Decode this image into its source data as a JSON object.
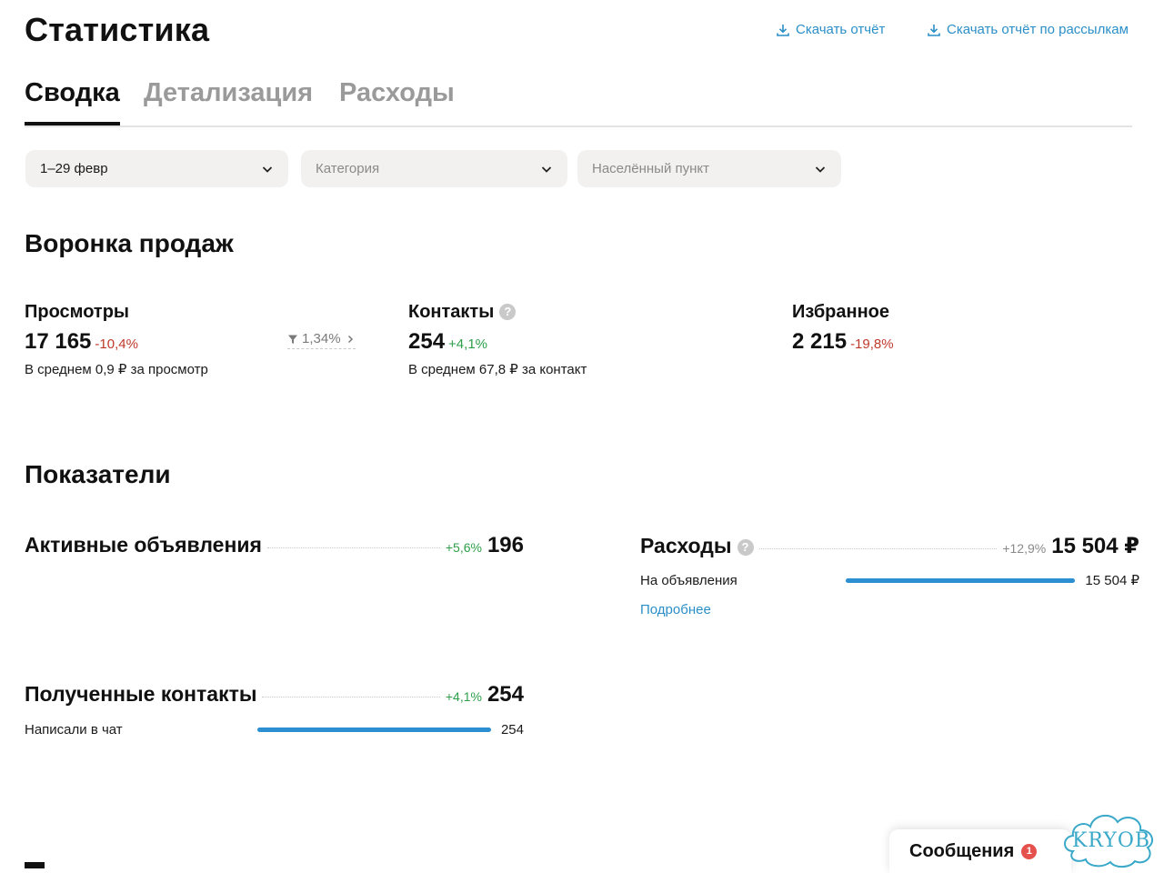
{
  "header": {
    "title": "Статистика",
    "download_report": "Скачать отчёт",
    "download_mailing_report": "Скачать отчёт по рассылкам"
  },
  "tabs": [
    {
      "label": "Сводка",
      "active": true
    },
    {
      "label": "Детализация",
      "active": false
    },
    {
      "label": "Расходы",
      "active": false
    }
  ],
  "filters": {
    "period": "1–29 февр",
    "category_placeholder": "Категория",
    "locality_placeholder": "Населённый пункт"
  },
  "funnel": {
    "title": "Воронка продаж",
    "views": {
      "label": "Просмотры",
      "value": "17 165",
      "delta": "-10,4%",
      "sub": "В среднем 0,9 ₽ за просмотр"
    },
    "conversion": "1,34%",
    "contacts": {
      "label": "Контакты",
      "value": "254",
      "delta": "+4,1%",
      "sub": "В среднем 67,8 ₽ за контакт"
    },
    "favorites": {
      "label": "Избранное",
      "value": "2 215",
      "delta": "-19,8%"
    }
  },
  "indicators": {
    "title": "Показатели",
    "active_ads": {
      "label": "Активные объявления",
      "delta": "+5,6%",
      "value": "196"
    },
    "expenses": {
      "label": "Расходы",
      "delta": "+12,9%",
      "value": "15 504 ₽",
      "breakdown": {
        "label": "На объявления",
        "value": "15 504 ₽",
        "fraction": 1.0
      },
      "more_link": "Подробнее"
    },
    "received_contacts": {
      "label": "Полученные контакты",
      "delta": "+4,1%",
      "value": "254",
      "breakdown": {
        "label": "Написали в чат",
        "value": "254",
        "fraction": 1.0
      }
    }
  },
  "messages": {
    "label": "Сообщения",
    "badge": "1"
  },
  "colors": {
    "accent_link": "#2b8fc7",
    "bar_fill": "#2b8fd1",
    "negative": "#c0392b",
    "positive": "#2e9e49",
    "badge": "#e5524d"
  }
}
